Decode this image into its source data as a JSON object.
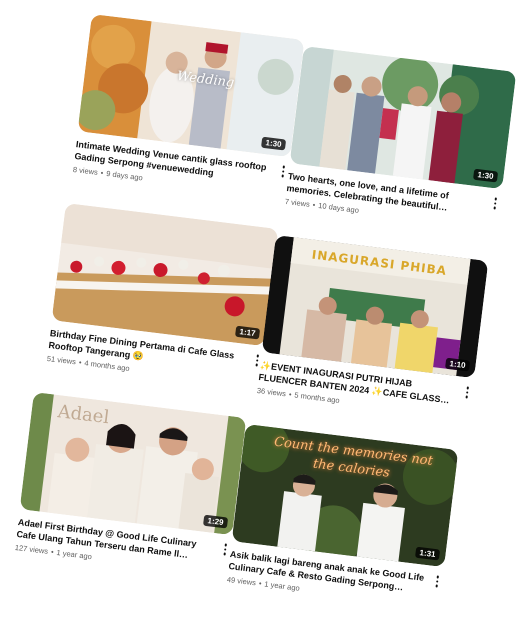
{
  "videos": [
    {
      "title": "Intimate Wedding Venue cantik glass rooftop Gading Serpong #venuewedding",
      "views": "8 views",
      "age": "9 days ago",
      "duration": "1:30",
      "thumb_overlay_text": "Wedding"
    },
    {
      "title": "Two hearts, one love, and a lifetime of memories. Celebrating the beautiful…",
      "views": "7 views",
      "age": "10 days ago",
      "duration": "1:30"
    },
    {
      "title": "Birthday Fine Dining Pertama di Cafe Glass Rooftop Tangerang 🥹",
      "views": "51 views",
      "age": "4 months ago",
      "duration": "1:17"
    },
    {
      "title": "✨EVENT INAGURASI PUTRI HIJAB FLUENCER BANTEN 2024 ✨CAFE GLASS…",
      "views": "36 views",
      "age": "5 months ago",
      "duration": "1:10",
      "thumb_overlay_text": "INAGURASI PHIBA"
    },
    {
      "title": "Adael First Birthday @ Good Life Culinary Cafe Ulang Tahun Terseru dan Rame ll…",
      "views": "127 views",
      "age": "1 year ago",
      "duration": "1:29",
      "thumb_overlay_text": "Adael"
    },
    {
      "title": "Asik balik lagi bareng anak anak ke Good Life Culinary Cafe & Resto Gading Serpong…",
      "views": "49 views",
      "age": "1 year ago",
      "duration": "1:31",
      "thumb_overlay_text": "Count the memories not the calories"
    }
  ]
}
